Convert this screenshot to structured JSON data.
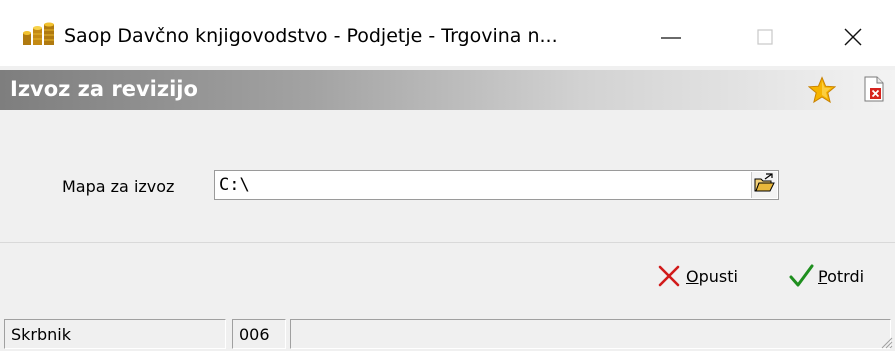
{
  "window": {
    "title": "Saop Davčno knjigovodstvo - Podjetje - Trgovina n...",
    "app_icon": "coin-stack-icon",
    "controls": [
      "minimize-icon",
      "maximize-icon",
      "close-icon"
    ]
  },
  "header": {
    "title": "Izvoz za revizijo",
    "icons": [
      "star-icon",
      "document-close-icon"
    ]
  },
  "form": {
    "export_folder_label": "Mapa za izvoz",
    "export_folder_value": "C:\\",
    "browse_icon": "folder-open-icon"
  },
  "actions": {
    "cancel_prefix": "",
    "cancel_underlined": "O",
    "cancel_rest": "pusti",
    "confirm_underlined": "P",
    "confirm_rest": "otrdi"
  },
  "status": {
    "user": "Skrbnik",
    "code": "006",
    "extra": ""
  },
  "colors": {
    "header_gradient_start": "#7e7e7e",
    "header_gradient_end": "#f3f3f3",
    "cancel_icon": "#d11a1a",
    "confirm_icon": "#1f8f1f",
    "star_icon": "#f6a800"
  }
}
